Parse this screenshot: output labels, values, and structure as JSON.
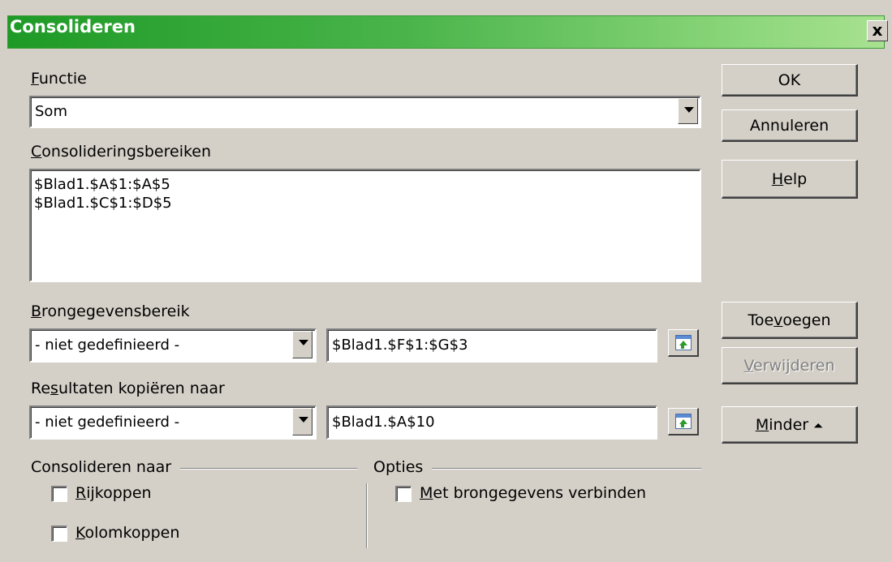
{
  "dialog": {
    "title": "Consolideren",
    "close_label": "x"
  },
  "function": {
    "label_accel": "F",
    "label_rest": "unctie",
    "value": "Som"
  },
  "consolidation_ranges": {
    "label_accel": "C",
    "label_rest": "onsolideringsbereiken",
    "items": [
      "$Blad1.$A$1:$A$5",
      "$Blad1.$C$1:$D$5"
    ]
  },
  "source_range": {
    "label_accel": "B",
    "label_rest": "rongegevensbereik",
    "dropdown_value": "- niet gedefinieerd -",
    "input_value": "$Blad1.$F$1:$G$3"
  },
  "copy_results": {
    "label_pre": "Re",
    "label_accel": "s",
    "label_post": "ultaten kopiëren naar",
    "dropdown_value": "- niet gedefinieerd -",
    "input_value": "$Blad1.$A$10"
  },
  "buttons": {
    "ok": "OK",
    "cancel": "Annuleren",
    "help_accel": "H",
    "help_rest": "elp",
    "add_pre": "Toe",
    "add_accel": "v",
    "add_post": "oegen",
    "delete_accel": "V",
    "delete_rest": "erwijderen",
    "less_accel": "M",
    "less_rest": "inder",
    "less_icon": "⏶"
  },
  "consolidate_to": {
    "title": "Consolideren naar",
    "row_headers_accel": "R",
    "row_headers_rest": "ijkoppen",
    "row_headers_checked": false,
    "col_headers_accel": "K",
    "col_headers_rest": "olomkoppen",
    "col_headers_checked": false
  },
  "options": {
    "title": "Opties",
    "link_accel": "M",
    "link_rest": "et brongegevens verbinden",
    "link_checked": false
  }
}
